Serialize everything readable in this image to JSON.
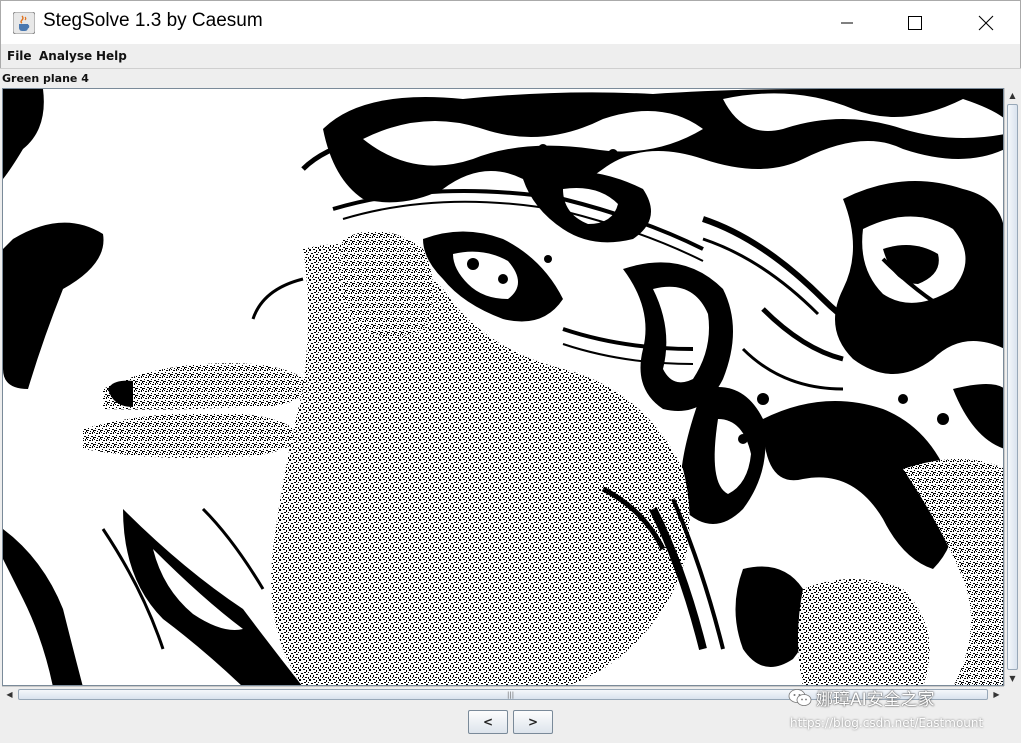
{
  "window": {
    "title": "StegSolve 1.3 by Caesum",
    "icon": "java-cup-icon",
    "controls": {
      "minimize": "minimize-icon",
      "maximize": "maximize-icon",
      "close": "close-icon"
    }
  },
  "menu": {
    "items": [
      {
        "label": "File"
      },
      {
        "label": "Analyse"
      },
      {
        "label": "Help"
      }
    ]
  },
  "viewer": {
    "plane_label": "Green plane 4",
    "image_colors": {
      "foreground": "#000000",
      "background": "#ffffff"
    }
  },
  "nav": {
    "prev_label": "<",
    "next_label": ">"
  },
  "watermark": {
    "text": "娜璋AI安全之家",
    "url": "https://blog.csdn.net/Eastmount"
  }
}
